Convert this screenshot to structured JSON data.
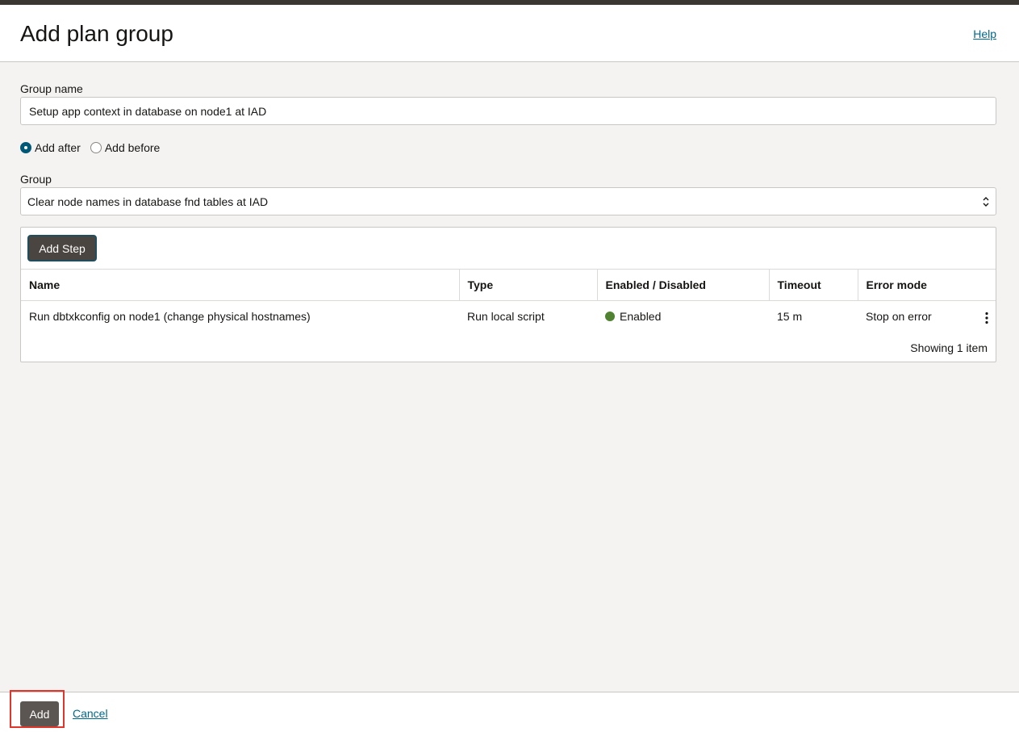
{
  "header": {
    "title": "Add plan group",
    "help_label": "Help"
  },
  "form": {
    "group_name_label": "Group name",
    "group_name_value": "Setup app context in database on node1 at IAD",
    "position": {
      "options": [
        "Add after",
        "Add before"
      ],
      "selected": "Add after"
    },
    "group_label": "Group",
    "group_value": "Clear node names in database fnd tables at IAD"
  },
  "steps": {
    "add_step_label": "Add Step",
    "columns": [
      "Name",
      "Type",
      "Enabled / Disabled",
      "Timeout",
      "Error mode"
    ],
    "rows": [
      {
        "name": "Run dbtxkconfig on node1 (change physical hostnames)",
        "type": "Run local script",
        "status": "Enabled",
        "timeout": "15 m",
        "error_mode": "Stop on error"
      }
    ],
    "count_text": "Showing 1 item",
    "status_color": "#508232"
  },
  "footer": {
    "add_label": "Add",
    "cancel_label": "Cancel"
  },
  "colors": {
    "accent": "#005879",
    "link": "#00688c",
    "highlight": "#e0352b"
  }
}
